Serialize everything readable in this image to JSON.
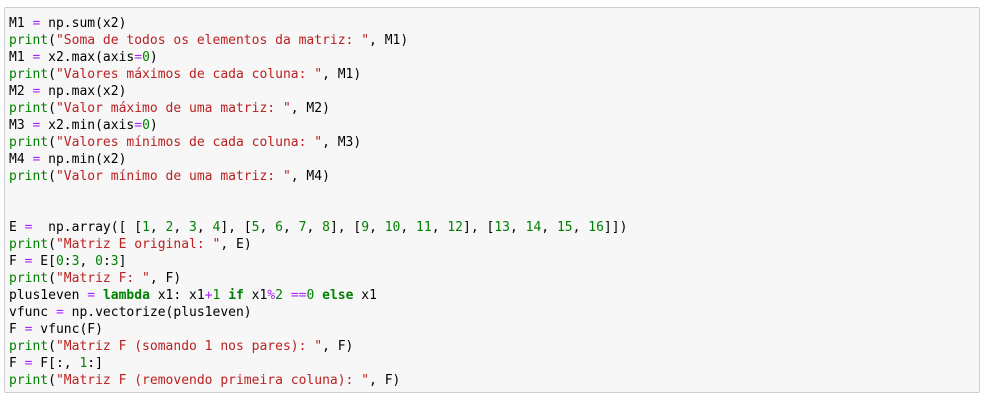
{
  "code_lines": [
    [
      [
        "t",
        "M1 "
      ],
      [
        "o",
        "="
      ],
      [
        "t",
        " np.sum(x2)"
      ]
    ],
    [
      [
        "b",
        "print"
      ],
      [
        "t",
        "("
      ],
      [
        "s",
        "\"Soma de todos os elementos da matriz: \""
      ],
      [
        "t",
        ", M1)"
      ]
    ],
    [
      [
        "t",
        "M1 "
      ],
      [
        "o",
        "="
      ],
      [
        "t",
        " x2.max(axis"
      ],
      [
        "o",
        "="
      ],
      [
        "n",
        "0"
      ],
      [
        "t",
        ")"
      ]
    ],
    [
      [
        "b",
        "print"
      ],
      [
        "t",
        "("
      ],
      [
        "s",
        "\"Valores máximos de cada coluna: \""
      ],
      [
        "t",
        ", M1)"
      ]
    ],
    [
      [
        "t",
        "M2 "
      ],
      [
        "o",
        "="
      ],
      [
        "t",
        " np.max(x2)"
      ]
    ],
    [
      [
        "b",
        "print"
      ],
      [
        "t",
        "("
      ],
      [
        "s",
        "\"Valor máximo de uma matriz: \""
      ],
      [
        "t",
        ", M2)"
      ]
    ],
    [
      [
        "t",
        "M3 "
      ],
      [
        "o",
        "="
      ],
      [
        "t",
        " x2.min(axis"
      ],
      [
        "o",
        "="
      ],
      [
        "n",
        "0"
      ],
      [
        "t",
        ")"
      ]
    ],
    [
      [
        "b",
        "print"
      ],
      [
        "t",
        "("
      ],
      [
        "s",
        "\"Valores mínimos de cada coluna: \""
      ],
      [
        "t",
        ", M3)"
      ]
    ],
    [
      [
        "t",
        "M4 "
      ],
      [
        "o",
        "="
      ],
      [
        "t",
        " np.min(x2)"
      ]
    ],
    [
      [
        "b",
        "print"
      ],
      [
        "t",
        "("
      ],
      [
        "s",
        "\"Valor mínimo de uma matriz: \""
      ],
      [
        "t",
        ", M4)"
      ]
    ],
    [],
    [],
    [
      [
        "t",
        "E "
      ],
      [
        "o",
        "="
      ],
      [
        "t",
        "  np.array([ ["
      ],
      [
        "n",
        "1"
      ],
      [
        "t",
        ", "
      ],
      [
        "n",
        "2"
      ],
      [
        "t",
        ", "
      ],
      [
        "n",
        "3"
      ],
      [
        "t",
        ", "
      ],
      [
        "n",
        "4"
      ],
      [
        "t",
        "], ["
      ],
      [
        "n",
        "5"
      ],
      [
        "t",
        ", "
      ],
      [
        "n",
        "6"
      ],
      [
        "t",
        ", "
      ],
      [
        "n",
        "7"
      ],
      [
        "t",
        ", "
      ],
      [
        "n",
        "8"
      ],
      [
        "t",
        "], ["
      ],
      [
        "n",
        "9"
      ],
      [
        "t",
        ", "
      ],
      [
        "n",
        "10"
      ],
      [
        "t",
        ", "
      ],
      [
        "n",
        "11"
      ],
      [
        "t",
        ", "
      ],
      [
        "n",
        "12"
      ],
      [
        "t",
        "], ["
      ],
      [
        "n",
        "13"
      ],
      [
        "t",
        ", "
      ],
      [
        "n",
        "14"
      ],
      [
        "t",
        ", "
      ],
      [
        "n",
        "15"
      ],
      [
        "t",
        ", "
      ],
      [
        "n",
        "16"
      ],
      [
        "t",
        "]])"
      ]
    ],
    [
      [
        "b",
        "print"
      ],
      [
        "t",
        "("
      ],
      [
        "s",
        "\"Matriz E original: \""
      ],
      [
        "t",
        ", E)"
      ]
    ],
    [
      [
        "t",
        "F "
      ],
      [
        "o",
        "="
      ],
      [
        "t",
        " E["
      ],
      [
        "n",
        "0"
      ],
      [
        "t",
        ":"
      ],
      [
        "n",
        "3"
      ],
      [
        "t",
        ", "
      ],
      [
        "n",
        "0"
      ],
      [
        "t",
        ":"
      ],
      [
        "n",
        "3"
      ],
      [
        "t",
        "]"
      ]
    ],
    [
      [
        "b",
        "print"
      ],
      [
        "t",
        "("
      ],
      [
        "s",
        "\"Matriz F: \""
      ],
      [
        "t",
        ", F)"
      ]
    ],
    [
      [
        "t",
        "plus1even "
      ],
      [
        "o",
        "="
      ],
      [
        "t",
        " "
      ],
      [
        "k",
        "lambda"
      ],
      [
        "t",
        " x1: x1"
      ],
      [
        "o",
        "+"
      ],
      [
        "n",
        "1"
      ],
      [
        "t",
        " "
      ],
      [
        "k",
        "if"
      ],
      [
        "t",
        " x1"
      ],
      [
        "o",
        "%"
      ],
      [
        "n",
        "2"
      ],
      [
        "t",
        " "
      ],
      [
        "o",
        "=="
      ],
      [
        "n",
        "0"
      ],
      [
        "t",
        " "
      ],
      [
        "k",
        "else"
      ],
      [
        "t",
        " x1"
      ]
    ],
    [
      [
        "t",
        "vfunc "
      ],
      [
        "o",
        "="
      ],
      [
        "t",
        " np.vectorize(plus1even)"
      ]
    ],
    [
      [
        "t",
        "F "
      ],
      [
        "o",
        "="
      ],
      [
        "t",
        " vfunc(F)"
      ]
    ],
    [
      [
        "b",
        "print"
      ],
      [
        "t",
        "("
      ],
      [
        "s",
        "\"Matriz F (somando 1 nos pares): \""
      ],
      [
        "t",
        ", F)"
      ]
    ],
    [
      [
        "t",
        "F "
      ],
      [
        "o",
        "="
      ],
      [
        "t",
        " F[:, "
      ],
      [
        "n",
        "1"
      ],
      [
        "t",
        ":]"
      ]
    ],
    [
      [
        "b",
        "print"
      ],
      [
        "t",
        "("
      ],
      [
        "s",
        "\"Matriz F (removendo primeira coluna): \""
      ],
      [
        "t",
        ", F)"
      ]
    ]
  ],
  "colors": {
    "keyword": "#008000",
    "builtin": "#008000",
    "string": "#ba2121",
    "number": "#008000",
    "operator": "#aa22ff",
    "cell_background": "#f7f7f7",
    "cell_border": "#cfcfcf"
  }
}
